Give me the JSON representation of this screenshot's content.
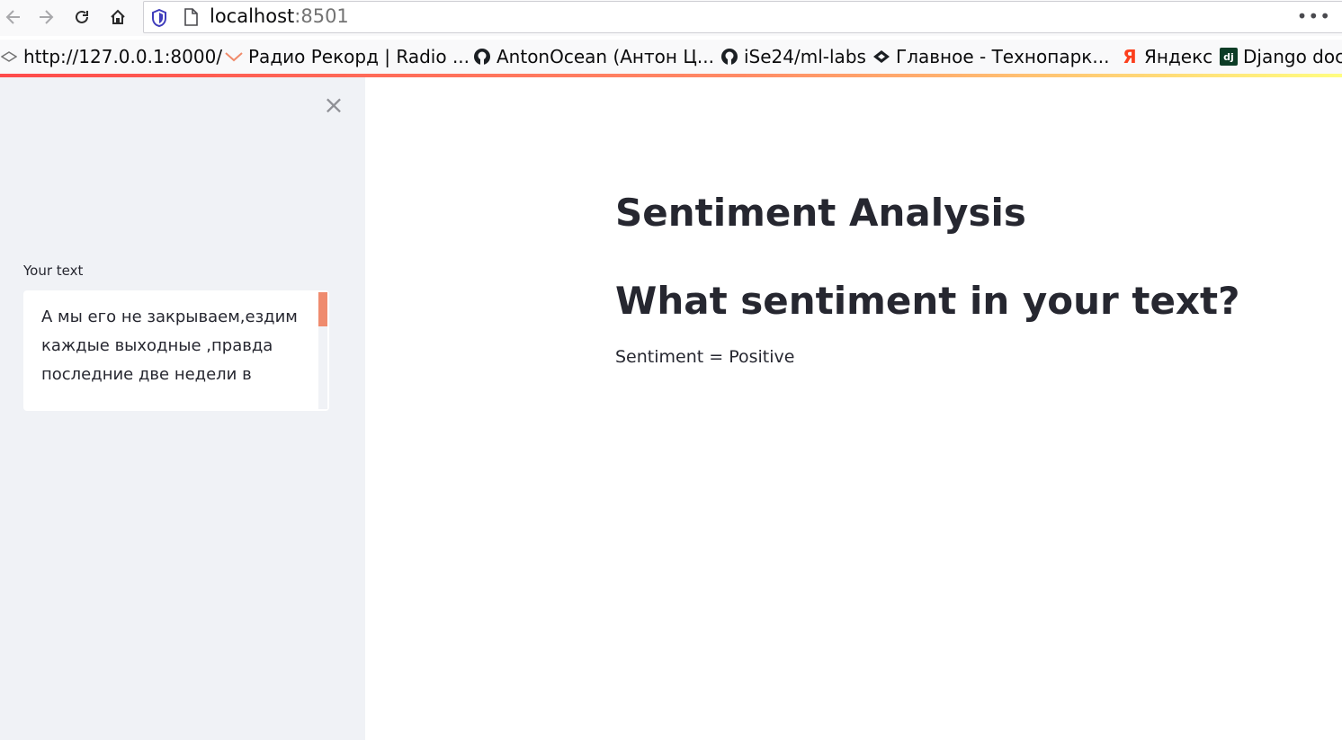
{
  "browser": {
    "url_host": "localhost",
    "url_port": ":8501",
    "more_label": "•••"
  },
  "bookmarks": [
    {
      "label": "http://127.0.0.1:8000/",
      "icon": "globe-icon"
    },
    {
      "label": "Радио Рекорд | Radio ...",
      "icon": "radio-record-icon"
    },
    {
      "label": "AntonOcean (Антон Ц...",
      "icon": "github-icon"
    },
    {
      "label": "iSe24/ml-labs",
      "icon": "github-icon"
    },
    {
      "label": "Главное - Технопарк...",
      "icon": "technopark-icon"
    },
    {
      "label": "Яндекс",
      "icon": "yandex-icon"
    },
    {
      "label": "Django doc",
      "icon": "django-icon"
    }
  ],
  "bookmark_icon_glyphs": {
    "yandex": "Я",
    "django": "dj"
  },
  "sidebar": {
    "close_glyph": "×",
    "field_label": "Your text",
    "text_value": "А мы его не закрываем,ездим каждые выходные ,правда последние две недели в"
  },
  "main": {
    "title": "Sentiment Analysis",
    "subtitle": "What sentiment in your text?",
    "result": "Sentiment = Positive"
  },
  "colors": {
    "accent": "#ff4b4b",
    "scroll_thumb": "#ef8b6e",
    "sidebar_bg": "#f0f2f6",
    "text": "#262730"
  }
}
